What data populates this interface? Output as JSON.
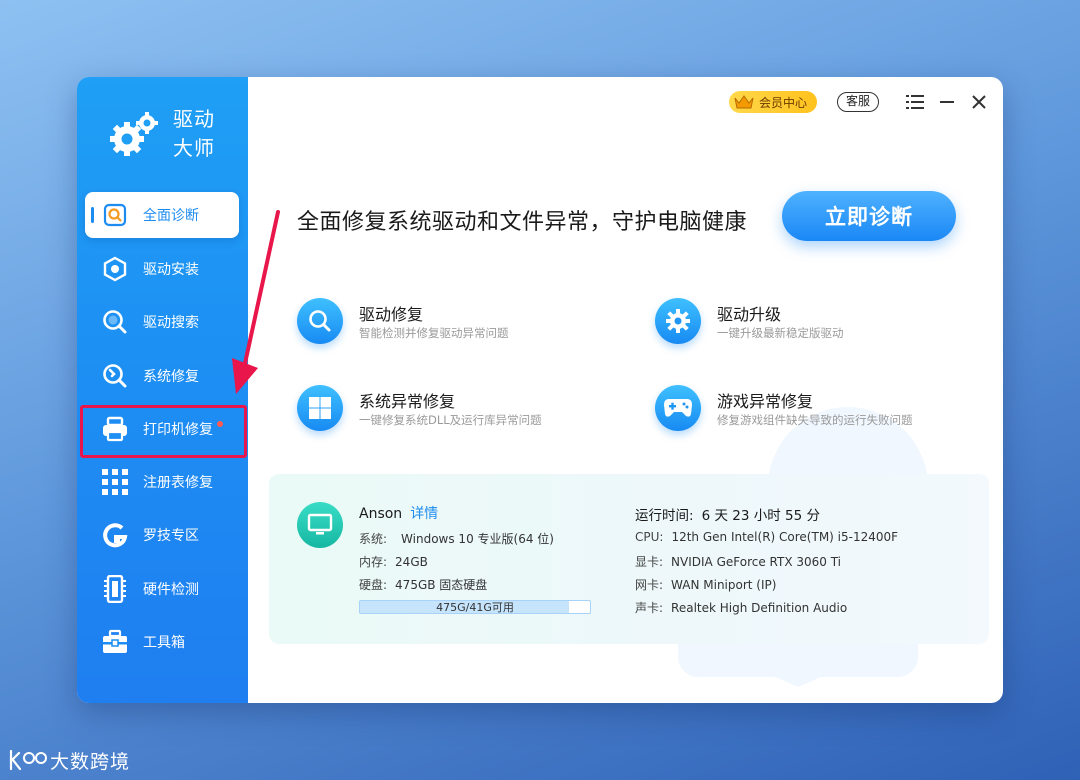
{
  "app": {
    "name_line1": "驱动",
    "name_line2": "大师"
  },
  "sidebar": {
    "items": [
      {
        "label": "全面诊断",
        "icon": "search-box-icon",
        "active": true
      },
      {
        "label": "驱动安装",
        "icon": "hex-nut-icon"
      },
      {
        "label": "驱动搜索",
        "icon": "magnifier-icon"
      },
      {
        "label": "系统修复",
        "icon": "wrench-icon"
      },
      {
        "label": "打印机修复",
        "icon": "printer-icon",
        "badge_dot": true
      },
      {
        "label": "注册表修复",
        "icon": "grid-icon"
      },
      {
        "label": "罗技专区",
        "icon": "logitech-g-icon"
      },
      {
        "label": "硬件检测",
        "icon": "memory-chip-icon"
      },
      {
        "label": "工具箱",
        "icon": "toolbox-icon"
      }
    ]
  },
  "topbar": {
    "vip_label": "会员中心",
    "service_label": "客服"
  },
  "main": {
    "headline": "全面修复系统驱动和文件异常，守护电脑健康",
    "diagnose_button": "立即诊断",
    "features": [
      {
        "title": "驱动修复",
        "subtitle": "智能检测并修复驱动异常问题",
        "icon": "magnifier-icon"
      },
      {
        "title": "驱动升级",
        "subtitle": "一键升级最新稳定版驱动",
        "icon": "gear-icon"
      },
      {
        "title": "系统异常修复",
        "subtitle": "一键修复系统DLL及运行库异常问题",
        "icon": "windows-icon"
      },
      {
        "title": "游戏异常修复",
        "subtitle": "修复游戏组件缺失导致的运行失败问题",
        "icon": "gamepad-icon"
      }
    ]
  },
  "system_info": {
    "user_name": "Anson",
    "details_link": "详情",
    "os_label": "系统:",
    "os_value": "Windows 10 专业版(64 位)",
    "ram_label": "内存:",
    "ram_value": "24GB",
    "disk_label": "硬盘:",
    "disk_value": "475GB 固态硬盘",
    "disk_usage_text": "475G/41G可用",
    "disk_used_fraction": 0.91,
    "uptime_label": "运行时间:",
    "uptime_value": "6 天 23 小时 55 分",
    "cpu_label": "CPU:",
    "cpu_value": "12th Gen Intel(R) Core(TM) i5-12400F",
    "gpu_label": "显卡:",
    "gpu_value": "NVIDIA GeForce RTX 3060 Ti",
    "nic_label": "网卡:",
    "nic_value": "WAN Miniport (IP)",
    "audio_label": "声卡:",
    "audio_value": "Realtek High Definition Audio"
  },
  "footer": {
    "brand_text": "大数跨境"
  },
  "colors": {
    "accent": "#1d8cf0",
    "sidebar_top": "#1f9ff5",
    "highlight": "#e8164a",
    "vip": "#ffc21e"
  }
}
